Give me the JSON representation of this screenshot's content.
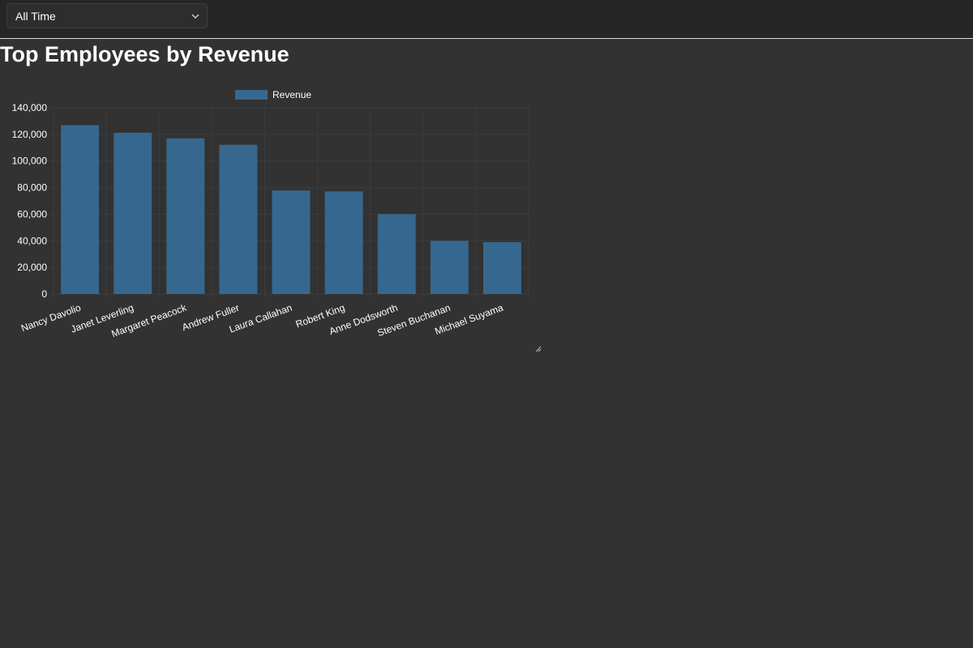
{
  "filter": {
    "selected": "All Time"
  },
  "page": {
    "title": "Top Employees by Revenue"
  },
  "colors": {
    "bar": "#36688f",
    "grid": "#3c3c3c",
    "text": "#ffffff",
    "background": "#323232"
  },
  "chart_data": {
    "type": "bar",
    "legend": {
      "position": "top",
      "entries": [
        "Revenue"
      ]
    },
    "grid": true,
    "categories": [
      "Nancy Davolio",
      "Janet Leverling",
      "Margaret Peacock",
      "Andrew Fuller",
      "Laura Callahan",
      "Robert King",
      "Anne Dodsworth",
      "Steven Buchanan",
      "Michael Suyama"
    ],
    "series": [
      {
        "name": "Revenue",
        "values": [
          126862,
          121207,
          116980,
          112128,
          77790,
          77137,
          60034,
          39998,
          38980
        ]
      }
    ],
    "ylim": [
      0,
      140000
    ],
    "yticks": [
      "0",
      "20,000",
      "40,000",
      "60,000",
      "80,000",
      "100,000",
      "120,000",
      "140,000"
    ],
    "xlabel": "",
    "ylabel": ""
  }
}
